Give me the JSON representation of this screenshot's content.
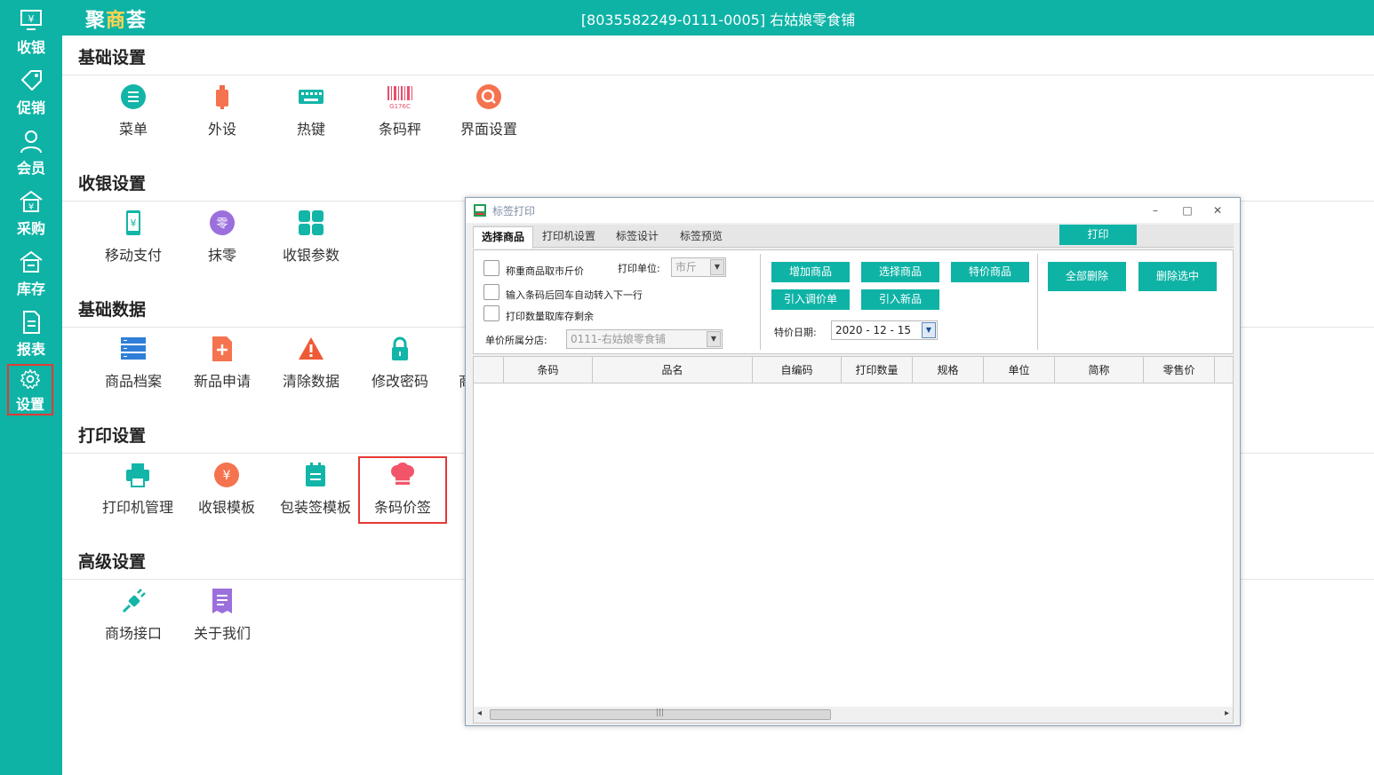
{
  "app": {
    "logo_main": "聚",
    "logo_accent": "商",
    "logo_tail": "荟",
    "store_title": "[8035582249-0111-0005] 右姑娘零食铺"
  },
  "sidebar": {
    "items": [
      {
        "label": "收银",
        "icon": "cashier-icon"
      },
      {
        "label": "促销",
        "icon": "promotion-tag-icon"
      },
      {
        "label": "会员",
        "icon": "member-icon"
      },
      {
        "label": "采购",
        "icon": "purchase-icon"
      },
      {
        "label": "库存",
        "icon": "inventory-icon"
      },
      {
        "label": "报表",
        "icon": "report-icon"
      },
      {
        "label": "设置",
        "icon": "gear-icon",
        "active": true
      }
    ]
  },
  "sections": [
    {
      "title": "基础设置",
      "tiles": [
        {
          "label": "菜单",
          "icon": "menu-list-icon"
        },
        {
          "label": "外设",
          "icon": "peripheral-icon"
        },
        {
          "label": "热键",
          "icon": "keyboard-icon"
        },
        {
          "label": "条码秤",
          "icon": "barcode-scale-icon",
          "icon_text": "G176C"
        },
        {
          "label": "界面设置",
          "icon": "interface-settings-icon"
        }
      ]
    },
    {
      "title": "收银设置",
      "tiles": [
        {
          "label": "移动支付",
          "icon": "mobile-pay-icon"
        },
        {
          "label": "抹零",
          "icon": "round-off-icon",
          "icon_text": "零"
        },
        {
          "label": "收银参数",
          "icon": "cashier-params-icon"
        }
      ]
    },
    {
      "title": "基础数据",
      "tiles": [
        {
          "label": "商品档案",
          "icon": "product-archive-icon"
        },
        {
          "label": "新品申请",
          "icon": "new-product-icon"
        },
        {
          "label": "清除数据",
          "icon": "clear-data-warning-icon"
        },
        {
          "label": "修改密码",
          "icon": "lock-icon"
        },
        {
          "label": "商",
          "icon": "hidden-tile-icon"
        }
      ]
    },
    {
      "title": "打印设置",
      "tiles": [
        {
          "label": "打印机管理",
          "icon": "printer-icon"
        },
        {
          "label": "收银模板",
          "icon": "cashier-template-icon"
        },
        {
          "label": "包装签模板",
          "icon": "package-label-icon"
        },
        {
          "label": "条码价签",
          "icon": "barcode-price-tag-icon",
          "highlighted": true
        }
      ]
    },
    {
      "title": "高级设置",
      "tiles": [
        {
          "label": "商场接口",
          "icon": "plug-interface-icon"
        },
        {
          "label": "关于我们",
          "icon": "about-doc-icon"
        }
      ]
    }
  ],
  "dialog": {
    "title": "标签打印",
    "window_controls": {
      "minimize": "–",
      "maximize": "□",
      "close": "✕"
    },
    "tabs": [
      "选择商品",
      "打印机设置",
      "标签设计",
      "标签预览"
    ],
    "print_button": "打印",
    "options": {
      "weigh_price": "称重商品取市斤价",
      "print_unit_label": "打印单位:",
      "print_unit_value": "市斤",
      "auto_next": "输入条码后回车自动转入下一行",
      "qty_from_stock": "打印数量取库存剩余",
      "branch_label": "单价所属分店:",
      "branch_value": "0111-右姑娘零食铺"
    },
    "buttons": {
      "add_product": "增加商品",
      "select_product": "选择商品",
      "special_product": "特价商品",
      "import_price_adjust": "引入调价单",
      "import_new": "引入新品",
      "delete_all": "全部删除",
      "delete_selected": "删除选中"
    },
    "special_date_label": "特价日期:",
    "special_date_value": "2020 - 12 - 15",
    "grid_columns": [
      "",
      "条码",
      "品名",
      "自编码",
      "打印数量",
      "规格",
      "单位",
      "简称",
      "零售价"
    ],
    "grid_rows": [],
    "scroll": {
      "left": "◂",
      "right": "▸",
      "thumb": "|||"
    }
  }
}
